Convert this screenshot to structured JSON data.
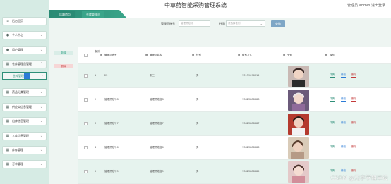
{
  "header": {
    "title": "中草药智能采购管理系统",
    "user_info": "管理员 admin  退出登录"
  },
  "sidebar": {
    "items": [
      {
        "label": "后台首页",
        "icon": "home-icon",
        "expandable": false
      },
      {
        "label": "个人中心",
        "icon": "user-icon",
        "expandable": true
      },
      {
        "label": "用户管理",
        "icon": "user-icon",
        "expandable": true
      },
      {
        "label": "仓库管理员管理",
        "icon": "grid-icon",
        "expandable": true
      },
      {
        "label": "药品分类管理",
        "icon": "grid-icon",
        "expandable": true
      },
      {
        "label": "供应商信息管理",
        "icon": "grid-icon",
        "expandable": true
      },
      {
        "label": "出库信息管理",
        "icon": "grid-icon",
        "expandable": true
      },
      {
        "label": "入库信息管理",
        "icon": "grid-icon",
        "expandable": true
      },
      {
        "label": "库存管理",
        "icon": "grid-icon",
        "expandable": true
      },
      {
        "label": "订单管理",
        "icon": "grid-icon",
        "expandable": true
      }
    ],
    "submenu": {
      "label": "仓库管理员"
    }
  },
  "tabs": {
    "breadcrumb": "后端首页",
    "current": "仓库管理员"
  },
  "search": {
    "label_account": "管理员账号",
    "placeholder_account": "管理员账号",
    "label_gender": "性别",
    "placeholder_gender": "请选择性别",
    "button": "查询"
  },
  "actions": {
    "add": "新增",
    "delete": "删除"
  },
  "table": {
    "columns": [
      "索引",
      "管理员账号",
      "管理员姓名",
      "性别",
      "联系方式",
      "头像",
      "操作"
    ],
    "rows": [
      {
        "index": "1",
        "account": "22",
        "name": "张三",
        "gender": "男",
        "phone": "13139696312",
        "avatar": "avatar-photo"
      },
      {
        "index": "2",
        "account": "管理员账号8",
        "name": "管理员姓名8",
        "gender": "男",
        "phone": "13823888888",
        "avatar": "avatar-photo"
      },
      {
        "index": "3",
        "account": "管理员账号7",
        "name": "管理员姓名7",
        "gender": "男",
        "phone": "13823888887",
        "avatar": "avatar-photo"
      },
      {
        "index": "4",
        "account": "管理员账号6",
        "name": "管理员姓名6",
        "gender": "男",
        "phone": "13823888886",
        "avatar": "avatar-photo"
      },
      {
        "index": "5",
        "account": "管理员账号5",
        "name": "管理员姓名5",
        "gender": "男",
        "phone": "13823888885",
        "avatar": "avatar-photo"
      }
    ],
    "ops": {
      "detail": "详情",
      "edit": "修改",
      "delete": "删除"
    }
  },
  "watermark": "CSDN @兄字学姐毕设",
  "colors": {
    "accent": "#2f8f79",
    "accent_light": "#3aa58a",
    "sidebar_bg": "#d6ebe4",
    "edit": "#2b7bd6",
    "danger": "#c43a3a",
    "button": "#7ea6c6"
  }
}
